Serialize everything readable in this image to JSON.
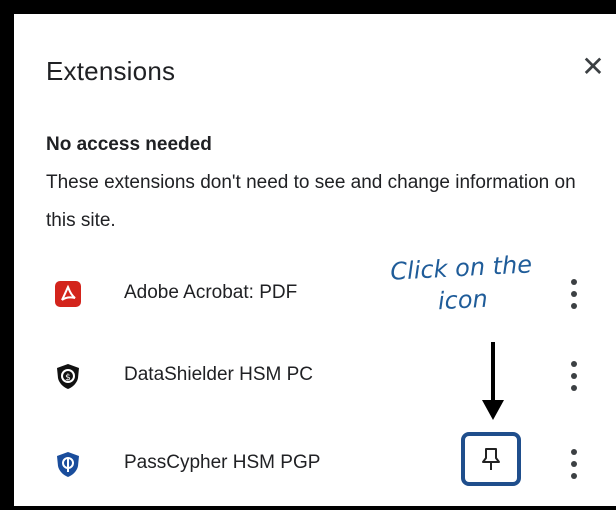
{
  "header": {
    "title": "Extensions",
    "close_glyph": "✕"
  },
  "section": {
    "title": "No access needed",
    "description": "These extensions don't need to see and change information on this site."
  },
  "extensions": [
    {
      "name": "Adobe Acrobat: PDF",
      "icon": "adobe-acrobat-icon",
      "color": "#d3241c"
    },
    {
      "name": "DataShielder HSM PC",
      "icon": "datashielder-shield-icon",
      "color": "#111111"
    },
    {
      "name": "PassCypher HSM PGP",
      "icon": "passcypher-shield-icon",
      "color": "#1a4d9c"
    }
  ],
  "annotation": {
    "line1": "Click on the",
    "line2": "icon",
    "color": "#1f5c99"
  },
  "pin_button": {
    "icon": "pin-icon",
    "border_color": "#1f4e8c"
  }
}
